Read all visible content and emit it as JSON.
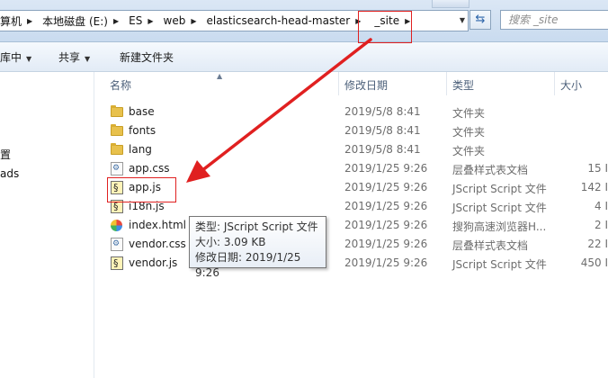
{
  "address_bar": {
    "crumbs": [
      "算机",
      "本地磁盘 (E:)",
      "ES",
      "web",
      "elasticsearch-head-master",
      "_site"
    ]
  },
  "search": {
    "placeholder": "搜索 _site"
  },
  "toolbar": {
    "library_label": "库中",
    "share_label": "共享",
    "new_folder_label": "新建文件夹"
  },
  "nav": {
    "items": [
      "置",
      "ads"
    ]
  },
  "columns": {
    "name": "名称",
    "modified": "修改日期",
    "type": "类型",
    "size": "大小"
  },
  "files": [
    {
      "name": "base",
      "modified": "2019/5/8 8:41",
      "type": "文件夹",
      "size": "",
      "icon": "folder-icon"
    },
    {
      "name": "fonts",
      "modified": "2019/5/8 8:41",
      "type": "文件夹",
      "size": "",
      "icon": "folder-icon"
    },
    {
      "name": "lang",
      "modified": "2019/5/8 8:41",
      "type": "文件夹",
      "size": "",
      "icon": "folder-icon"
    },
    {
      "name": "app.css",
      "modified": "2019/1/25 9:26",
      "type": "层叠样式表文档",
      "size": "15 I",
      "icon": "css-file-icon"
    },
    {
      "name": "app.js",
      "modified": "2019/1/25 9:26",
      "type": "JScript Script 文件",
      "size": "142 I",
      "icon": "js-file-icon"
    },
    {
      "name": "i18n.js",
      "modified": "2019/1/25 9:26",
      "type": "JScript Script 文件",
      "size": "4 I",
      "icon": "js-file-icon"
    },
    {
      "name": "index.html",
      "modified": "2019/1/25 9:26",
      "type": "搜狗高速浏览器H...",
      "size": "2 I",
      "icon": "html-file-icon"
    },
    {
      "name": "vendor.css",
      "modified": "2019/1/25 9:26",
      "type": "层叠样式表文档",
      "size": "22 I",
      "icon": "css-file-icon"
    },
    {
      "name": "vendor.js",
      "modified": "2019/1/25 9:26",
      "type": "JScript Script 文件",
      "size": "450 I",
      "icon": "js-file-icon"
    }
  ],
  "tooltip": {
    "type_line": "类型: JScript Script 文件",
    "size_line": "大小: 3.09 KB",
    "date_line": "修改日期: 2019/1/25 9:26"
  },
  "colors": {
    "annotation_red": "#e02020",
    "folder_yellow": "#e8c14c",
    "header_text": "#4c607a"
  }
}
